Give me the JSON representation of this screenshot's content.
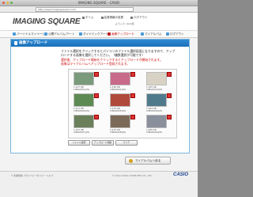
{
  "window": {
    "title": "IMAGING SQUARE - CASIO",
    "url": "http://www.imagingsquare.com/"
  },
  "header": {
    "logo": "IMAGING SQUARE",
    "links": [
      "ホーム",
      "会員情報の変更",
      "ログアウト"
    ],
    "welcome": "ようこそ casio様"
  },
  "nav": {
    "items": [
      "パーソナルマイページ",
      "公開アルバム/アート",
      "ダイナミックアート",
      "画像アップロード",
      "マイアルバム",
      "ログアウト"
    ],
    "active_index": 3
  },
  "panel": {
    "title": "画像アップロード",
    "instructions": [
      "ファイル選択をクリックするとパソコンのファイル選択画面になりますので、アップ",
      "ロードする画像を選択してください。（複数選択が可能です）",
      "選択後、アップロード開始をクリックするとアップロードが開始されます。",
      "画像はマイアルバムへアップロード登録されます。"
    ]
  },
  "photos": [
    {
      "name": "CIMG0001.JPG",
      "size": "1,247 KB",
      "color": "#7a9a7c"
    },
    {
      "name": "CIMG0002.JPG",
      "size": "1,198 KB",
      "color": "#c86a8a"
    },
    {
      "name": "CIMG0003.JPG",
      "size": "1,305 KB",
      "color": "#d8d2c4"
    },
    {
      "name": "CIMG0004.JPG",
      "size": "1,211 KB",
      "color": "#5d8a52"
    },
    {
      "name": "CIMG0005.JPG",
      "size": "1,176 KB",
      "color": "#b04a3a"
    },
    {
      "name": "CIMG0006.JPG",
      "size": "1,264 KB",
      "color": "#4f7a8c"
    },
    {
      "name": "CIMG0007.JPG",
      "size": "1,152 KB",
      "color": "#6a7f5a"
    },
    {
      "name": "CIMG0008.JPG",
      "size": "1,233 KB",
      "color": "#7c6a58"
    },
    {
      "name": "CIMG0009.JPG",
      "size": "1,289 KB",
      "color": "#8a8f9c"
    }
  ],
  "grid_buttons": [
    "ファイル選択",
    "アップロード開始",
    "クリア"
  ],
  "back_button": "マイアルバムへ戻る",
  "footer": {
    "links": "© 利用規約  プライバシーポリシー  ヘルプ",
    "copyright": "© 2014 CASIO COMPUTER CO., LTD.",
    "brand": "CASIO"
  }
}
